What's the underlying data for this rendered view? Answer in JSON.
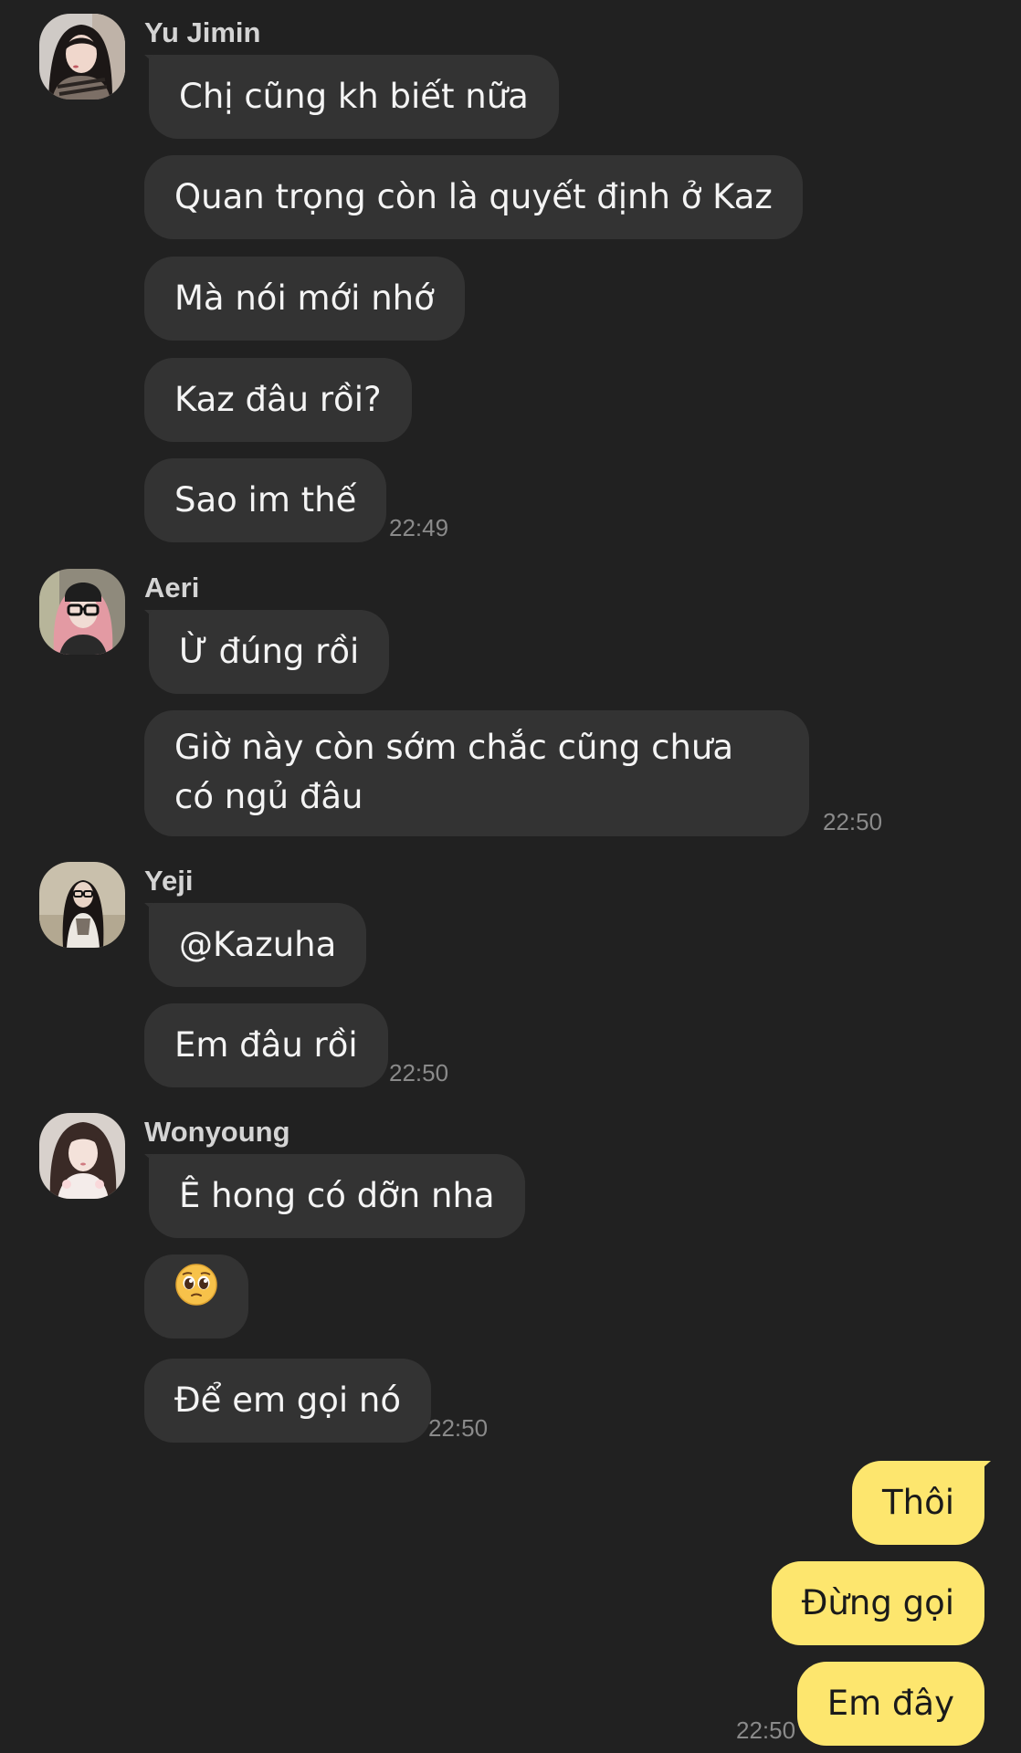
{
  "messages": {
    "yu_jimin": {
      "sender": "Yu Jimin",
      "lines": [
        "Chị cũng kh biết nữa",
        "Quan trọng còn là quyết định ở Kaz",
        "Mà nói mới nhớ",
        "Kaz đâu rồi?",
        "Sao im thế"
      ],
      "time": "22:49"
    },
    "aeri": {
      "sender": "Aeri",
      "lines": [
        "Ừ đúng rồi",
        "Giờ này còn sớm chắc cũng chưa có ngủ đâu"
      ],
      "time": "22:50"
    },
    "yeji": {
      "sender": "Yeji",
      "lines": [
        "@Kazuha",
        "Em đâu rồi"
      ],
      "time": "22:50"
    },
    "wonyoung": {
      "sender": "Wonyoung",
      "lines": [
        "Ê hong có dỡn nha",
        "🥺",
        "Để em gọi nó"
      ],
      "time": "22:50"
    },
    "me": {
      "lines": [
        "Thôi",
        "Đừng gọi",
        "Em đây"
      ],
      "time": "22:50"
    }
  },
  "colors": {
    "background": "#212121",
    "incoming_bubble": "#333333",
    "outgoing_bubble": "#fde66e",
    "timestamp": "#8a8a8a"
  }
}
